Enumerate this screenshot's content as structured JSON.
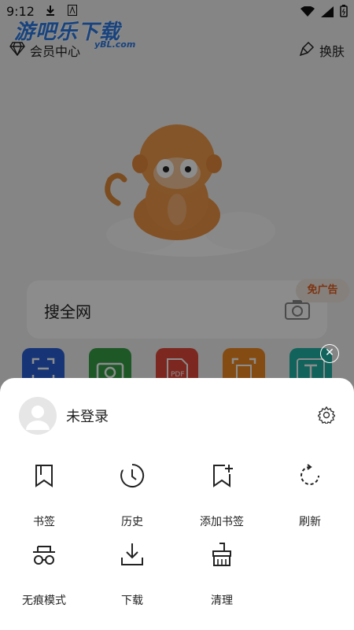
{
  "status_bar": {
    "time": "9:12"
  },
  "watermark": {
    "title": "游吧乐下载",
    "sub": "yBL.com"
  },
  "header": {
    "member_center": "会员中心",
    "skin": "换肤"
  },
  "search": {
    "placeholder": "搜全网",
    "ad_free": "免广告"
  },
  "user": {
    "login_status": "未登录"
  },
  "menu": {
    "items": [
      {
        "label": "书签",
        "icon": "bookmark-icon"
      },
      {
        "label": "历史",
        "icon": "history-icon"
      },
      {
        "label": "添加书签",
        "icon": "add-bookmark-icon"
      },
      {
        "label": "刷新",
        "icon": "refresh-icon"
      },
      {
        "label": "无痕模式",
        "icon": "incognito-icon"
      },
      {
        "label": "下载",
        "icon": "download-icon"
      },
      {
        "label": "清理",
        "icon": "clean-icon"
      }
    ]
  },
  "colors": {
    "quick_blue": "#2a62d8",
    "quick_green": "#35a046",
    "quick_red": "#e24a3b",
    "quick_orange": "#f08a24",
    "quick_teal": "#1fb5a8",
    "ad_text": "#e35d20",
    "watermark": "#2d7be5"
  }
}
